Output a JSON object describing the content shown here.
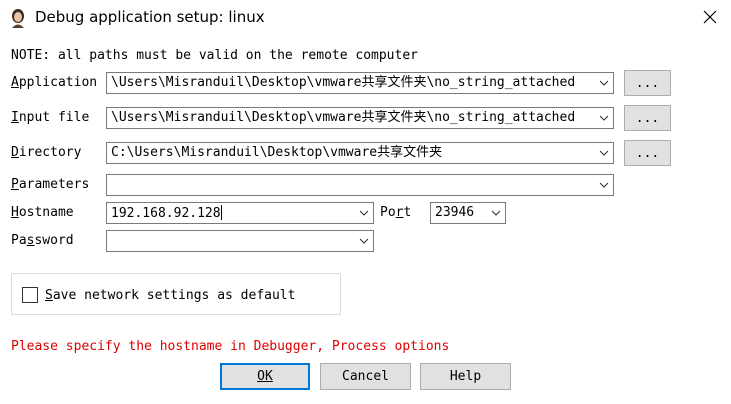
{
  "window": {
    "title": "Debug application setup: linux"
  },
  "note": "NOTE: all paths must be valid on the remote computer",
  "fields": {
    "application": {
      "label_key": "A",
      "label_rest": "pplication",
      "value": "\\Users\\Misranduil\\Desktop\\vmware共享文件夹\\no_string_attached",
      "browse_label": "..."
    },
    "input_file": {
      "label_key": "I",
      "label_rest": "nput file",
      "value": "\\Users\\Misranduil\\Desktop\\vmware共享文件夹\\no_string_attached",
      "browse_label": "..."
    },
    "directory": {
      "label_key": "D",
      "label_rest": "irectory",
      "value": "C:\\Users\\Misranduil\\Desktop\\vmware共享文件夹",
      "browse_label": "..."
    },
    "parameters": {
      "label_key": "P",
      "label_rest": "arameters",
      "value": ""
    },
    "hostname": {
      "label_key": "H",
      "label_rest": "ostname",
      "value": "192.168.92.128"
    },
    "port": {
      "label_pre": "Po",
      "label_key": "r",
      "label_rest": "t",
      "value": "23946"
    },
    "password": {
      "label_pre": "Pa",
      "label_key": "s",
      "label_rest": "sword",
      "value": ""
    }
  },
  "save_default": {
    "label_key": "S",
    "label_rest": "ave network settings as default",
    "checked": false
  },
  "error_message": "Please specify the hostname in Debugger, Process options",
  "buttons": {
    "ok": "OK",
    "cancel": "Cancel",
    "help": "Help"
  },
  "icons": {
    "app": "avatar-icon",
    "close": "close-icon",
    "dropdown": "chevron-down-icon"
  }
}
